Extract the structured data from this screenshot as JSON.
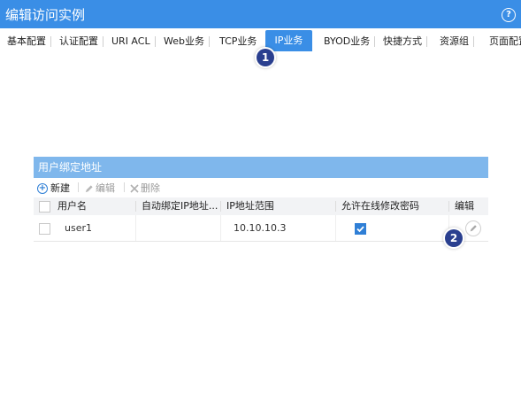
{
  "window": {
    "title": "编辑访问实例",
    "help_glyph": "?"
  },
  "tabs": [
    {
      "label": "基本配置"
    },
    {
      "label": "认证配置"
    },
    {
      "label": "URI ACL"
    },
    {
      "label": "Web业务"
    },
    {
      "label": "TCP业务"
    },
    {
      "label": "IP业务",
      "active": true
    },
    {
      "label": "BYOD业务"
    },
    {
      "label": "快捷方式"
    },
    {
      "label": "资源组"
    },
    {
      "label": "页面配置"
    }
  ],
  "callouts": {
    "one": "1",
    "two": "2"
  },
  "panel": {
    "title": "用户绑定地址",
    "toolbar": {
      "new_label": "新建",
      "edit_label": "编辑",
      "delete_label": "删除"
    },
    "columns": [
      "用户名",
      "自动绑定IP地址...",
      "IP地址范围",
      "允许在线修改密码",
      "编辑"
    ],
    "rows": [
      {
        "username": "user1",
        "auto_bind": "",
        "ip_range": "10.10.10.3",
        "allow_change_password": true
      }
    ]
  },
  "colors": {
    "titlebar": "#3a8ee6",
    "panel_header": "#7fb7ec",
    "callout": "#2a3f8f",
    "accent": "#2f7fd6"
  },
  "icons": [
    "help-icon",
    "plus-icon",
    "pencil-icon",
    "close-icon",
    "checkbox-icon"
  ]
}
